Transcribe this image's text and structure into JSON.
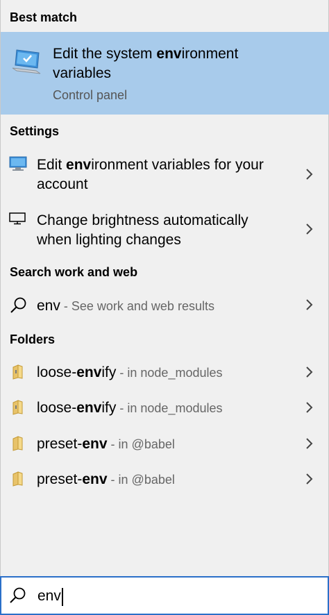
{
  "sections": {
    "best_match": "Best match",
    "settings": "Settings",
    "search_web": "Search work and web",
    "folders": "Folders"
  },
  "best": {
    "title_pre": "Edit the system ",
    "title_bold": "env",
    "title_post": "ironment variables",
    "subtitle": "Control panel",
    "icon": "monitor-check-icon"
  },
  "settings_items": [
    {
      "pre": "Edit ",
      "bold": "env",
      "post": "ironment variables for your account",
      "icon": "monitor-settings-icon"
    },
    {
      "pre": "Change brightness automatically when lighting changes",
      "bold": "",
      "post": "",
      "icon": "display-icon"
    }
  ],
  "web": {
    "query": "env",
    "suffix": " - See work and web results",
    "icon": "search-icon"
  },
  "folders": [
    {
      "pre": "loose-",
      "bold": "env",
      "post": "ify",
      "loc": " - in node_modules",
      "icon": "folder-icon"
    },
    {
      "pre": "loose-",
      "bold": "env",
      "post": "ify",
      "loc": " - in node_modules",
      "icon": "folder-icon"
    },
    {
      "pre": "preset-",
      "bold": "env",
      "post": "",
      "loc": " - in @babel",
      "icon": "folder-icon"
    },
    {
      "pre": "preset-",
      "bold": "env",
      "post": "",
      "loc": " - in @babel",
      "icon": "folder-icon"
    }
  ],
  "search": {
    "value": "env",
    "icon": "search-icon"
  },
  "colors": {
    "selected": "#a8cbeb",
    "background": "#f0f0f0",
    "focus_border": "#2a6fc9"
  }
}
